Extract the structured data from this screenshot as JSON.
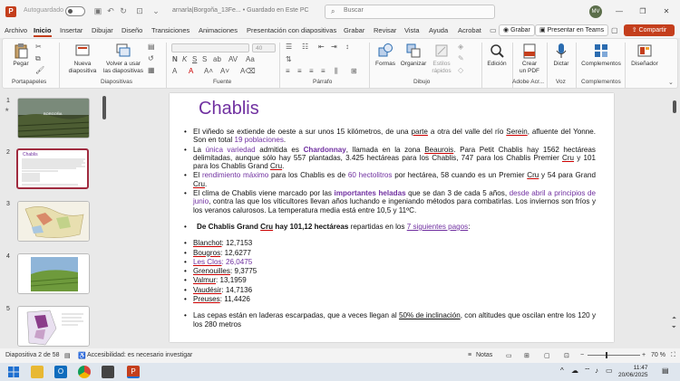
{
  "titlebar": {
    "autosave_label": "Autoguardado",
    "filename": "arnarla|Borgoña_13Fe... • Guardado en Este PC",
    "search_placeholder": "Buscar",
    "user_initials": "MV"
  },
  "tabs": [
    "Archivo",
    "Inicio",
    "Insertar",
    "Dibujar",
    "Diseño",
    "Transiciones",
    "Animaciones",
    "Presentación con diapositivas",
    "Grabar",
    "Revisar",
    "Vista",
    "Ayuda",
    "Acrobat"
  ],
  "tab_buttons": {
    "record": "Grabar",
    "present_teams": "Presentar en Teams",
    "share": "Compartir"
  },
  "ribbon": {
    "paste": "Pegar",
    "new_slide_1": "Nueva",
    "new_slide_2": "diapositiva",
    "reuse_1": "Volver a usar",
    "reuse_2": "las diapositivas",
    "font_size": "40",
    "shapes": "Formas",
    "arrange": "Organizar",
    "quick_styles_1": "Estilos",
    "quick_styles_2": "rápidos",
    "edit": "Edición",
    "create_pdf_1": "Crear",
    "create_pdf_2": "un PDF",
    "dictate": "Dictar",
    "addins": "Complementos",
    "designer": "Diseñador",
    "groups": {
      "clipboard": "Portapapeles",
      "slides": "Diapositivas",
      "font": "Fuente",
      "paragraph": "Párrafo",
      "drawing": "Dibujo",
      "adobe": "Adobe Acr...",
      "voice": "Voz",
      "addins": "Complementos"
    }
  },
  "thumbnails": [
    "1",
    "2",
    "3",
    "4",
    "5"
  ],
  "thumb1_caption": "BORGOÑA",
  "thumb2_title": "Chablis",
  "slide": {
    "title": "Chablis",
    "p1a": "El viñedo se extiende de oeste a sur unos 15 kilómetros, de una ",
    "p1_parte": "parte",
    "p1b": " a otra del valle del río ",
    "p1_serein": "Serein",
    "p1c": ", afluente del Yonne. Son en total ",
    "p1_pob": "19 poblaciones",
    "p1d": ".",
    "p2a": "La ",
    "p2_unica": "única variedad",
    "p2b": " admitida es ",
    "p2_chard": "Chardonnay",
    "p2c": ", llamada en la zona ",
    "p2_beau": "Beaurois",
    "p2d": ". Para Petit Chablis hay 1562 hectáreas delimitadas, aunque sólo hay 557 plantadas, 3.425 hectáreas para los Chablis, 747 para los Chablis Premier ",
    "p2_cru1": "Cru",
    "p2e": " y 101 para los Chablis Grand ",
    "p2_cru2": "Cru",
    "p2f": ".",
    "p3a": "El ",
    "p3_rend": "rendimiento máximo",
    "p3b": " para los Chablis es de ",
    "p3_hl": "60 hectolitros",
    "p3c": " por hectárea, 58 cuando es un Premier ",
    "p3_cru1": "Cru",
    "p3d": " y 54 para Grand ",
    "p3_cru2": "Cru",
    "p3e": ".",
    "p4a": "El clima de Chablis viene marcado por las ",
    "p4_hel": "importantes heladas",
    "p4b": " que se dan 3 de cada 5 años, ",
    "p4_abr": "desde abril a principios de junio",
    "p4c": ", contra las que los viticultores llevan años luchando e ingeniando métodos para combatirlas. Los inviernos son fríos y los veranos calurosos. La temperatura media está entre 10,5 y 11ºC.",
    "p5a": "De Chablis Grand ",
    "p5_cru": "Cru",
    "p5b": " hay 101,12 hectáreas",
    "p5c": " repartidas en los  ",
    "p5_link": "7 siguientes pagos",
    "p5d": ":",
    "pagos": [
      {
        "name": "Blanchot",
        "value": ": 12,7153",
        "purple": false
      },
      {
        "name": "Bougros",
        "value": ": 12,6277",
        "purple": false
      },
      {
        "name": "Les Clos",
        "value": ": 26,0475",
        "purple": true
      },
      {
        "name": "Grenouilles",
        "value": ": 9,3775",
        "purple": false
      },
      {
        "name": "Valmur",
        "value": ": 13,1959",
        "purple": false
      },
      {
        "name": "Vaudésir",
        "value": ": 14,7136",
        "purple": false
      },
      {
        "name": "Preuses",
        "value": ": 11,4426",
        "purple": false
      }
    ],
    "p6a": "Las cepas están en laderas escarpadas, que a veces llegan al ",
    "p6_incl": "50% de inclinación",
    "p6b": ", con altitudes que oscilan entre los 120 y los 280 metros"
  },
  "status": {
    "slide_info": "Diapositiva 2 de 58",
    "accessibility": "Accesibilidad: es necesario investigar",
    "notes": "Notas",
    "zoom": "70 %"
  },
  "taskbar": {
    "time": "11:47",
    "date": "20/06/2025"
  },
  "colors": {
    "accent": "#c43e1c",
    "title_purple": "#7030a0",
    "active_thumb_border": "#a02b3f"
  }
}
